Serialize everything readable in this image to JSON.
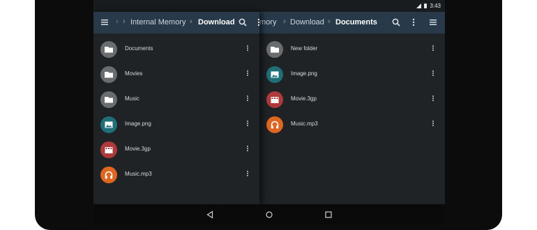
{
  "status": {
    "time": "3:43"
  },
  "left_pane": {
    "breadcrumbs": [
      {
        "label": "Internal Memory",
        "active": false
      },
      {
        "label": "Download",
        "active": true
      }
    ],
    "files": [
      {
        "name": "Documents",
        "type": "folder",
        "color": "#6a6d70"
      },
      {
        "name": "Movies",
        "type": "folder",
        "color": "#6a6d70"
      },
      {
        "name": "Music",
        "type": "folder",
        "color": "#6a6d70"
      },
      {
        "name": "Image.png",
        "type": "image",
        "color": "#1f6f78"
      },
      {
        "name": "Movie.3gp",
        "type": "video",
        "color": "#b03a3a"
      },
      {
        "name": "Music.mp3",
        "type": "audio",
        "color": "#e0661f"
      }
    ]
  },
  "right_pane": {
    "breadcrumbs": [
      {
        "label": "mory",
        "active": false
      },
      {
        "label": "Download",
        "active": false
      },
      {
        "label": "Documents",
        "active": true
      }
    ],
    "files": [
      {
        "name": "New folder",
        "type": "folder",
        "color": "#6a6d70"
      },
      {
        "name": "Image.png",
        "type": "image",
        "color": "#1f6f78"
      },
      {
        "name": "Movie.3gp",
        "type": "video",
        "color": "#b03a3a"
      },
      {
        "name": "Music.mp3",
        "type": "audio",
        "color": "#e0661f"
      }
    ]
  },
  "theme": {
    "appbar": "#283a4a",
    "background": "#1f2326"
  }
}
